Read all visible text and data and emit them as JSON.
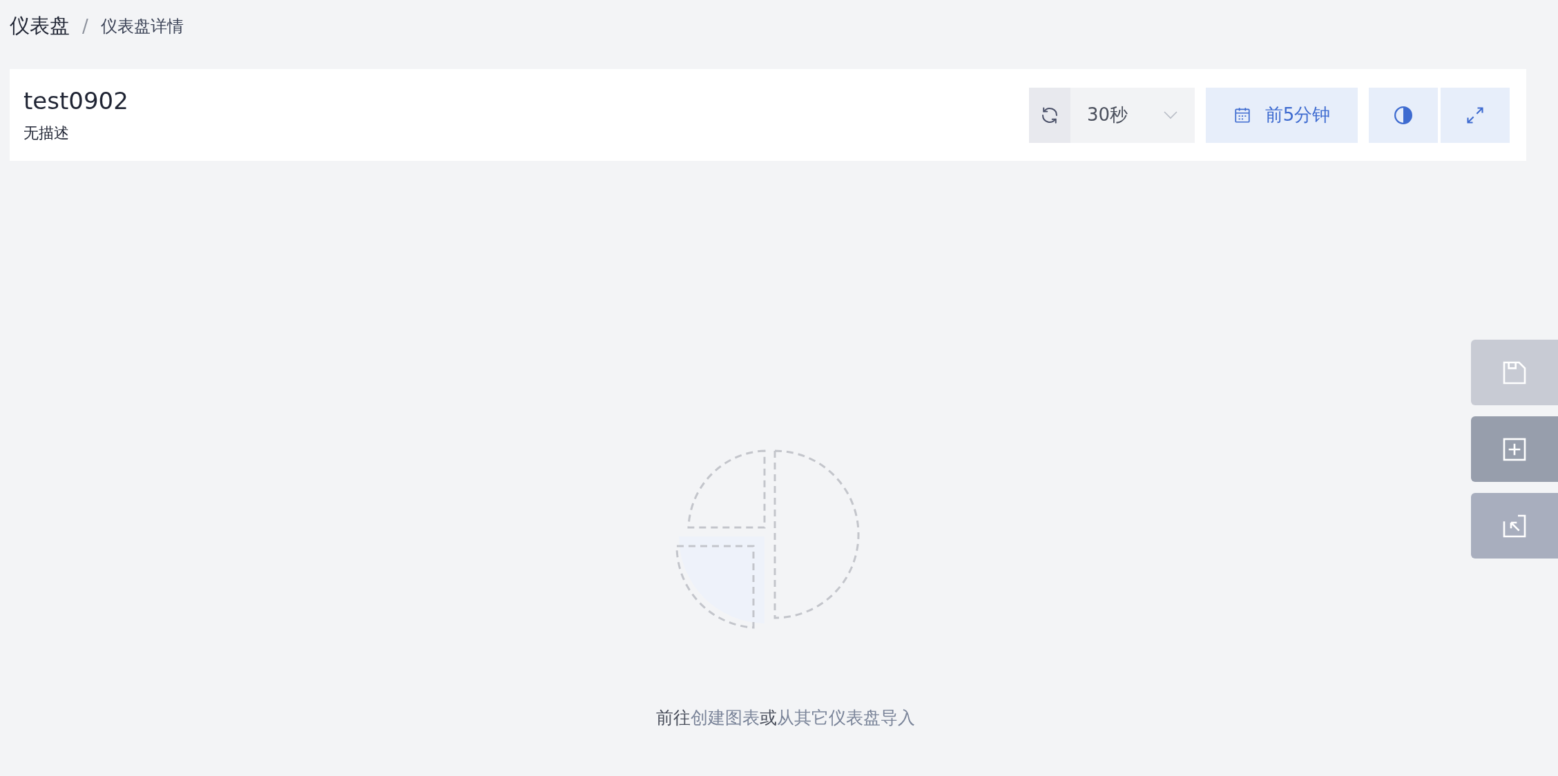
{
  "breadcrumb": [
    {
      "label": "仪表盘",
      "current": false
    },
    {
      "label": "仪表盘详情",
      "current": true
    }
  ],
  "breadcrumb_separator": "/",
  "dashboard": {
    "title": "test0902",
    "description": "无描述"
  },
  "toolbar": {
    "refresh_interval": "30秒",
    "time_range": "前5分钟"
  },
  "empty_state": {
    "message": [
      {
        "kind": "text",
        "text": "前往"
      },
      {
        "kind": "link",
        "text": "创建图表"
      },
      {
        "kind": "text",
        "text": "或"
      },
      {
        "kind": "link",
        "text": "从其它仪表盘导入"
      }
    ]
  },
  "side_actions": [
    {
      "kind": "save"
    },
    {
      "kind": "add"
    },
    {
      "kind": "import"
    }
  ]
}
